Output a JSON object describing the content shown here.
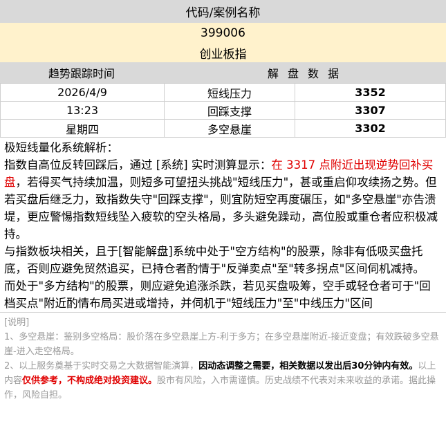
{
  "header": {
    "title": "代码/案例名称"
  },
  "stock": {
    "code": "399006",
    "name": "创业板指"
  },
  "subheader": {
    "col1": "趋势跟踪时间",
    "col2": "解 盘 数 据"
  },
  "rows": [
    {
      "info": "2026/4/9",
      "label": "短线压力",
      "value": "3352"
    },
    {
      "info": "13:23",
      "label": "回踩支撑",
      "value": "3307"
    },
    {
      "info": "星期四",
      "label": "多空悬崖",
      "value": "3302"
    }
  ],
  "analysis": {
    "heading": "极短线量化系统解析：",
    "p1_a": "指数自高位反转回踩后，通过 [系统] 实时测算显示：",
    "p1_red": "在 3317 点附近出现逆势回补买盘",
    "p1_b": "，若得买气持续加温，则短多可望扭头挑战\"短线压力\"，甚或重启仰攻续扬之势。但若买盘后继乏力，致指数失守\"回踩支撑\"，则宜防短空再度碾压，如\"多空悬崖\"亦告溃堤，更应警惕指数短线坠入疲软的空头格局，多头避免躁动，高位股或重仓者应积极减持。",
    "p2": "与指数板块相关，且于[智能解盘]系统中处于\"空方结构\"的股票，除非有低吸买盘托底，否则应避免贸然追买，已持仓者酌情于\"反弹卖点\"至\"转多拐点\"区间伺机减持。",
    "p3": "而处于\"多方结构\"的股票，则应避免追涨杀跌，若见买盘吸筹，空手或轻仓者可于\"回档买点\"附近酌情布局买进或增持，并伺机于\"短线压力\"至\"中线压力\"区间"
  },
  "notes": {
    "title": "[说明]",
    "n1": "1、多空悬崖：鉴别多空格局：股价落在多空悬崖上方-利于多方；在多空悬崖附近-接近变盘；有效跌破多空悬崖-进入走空格局。",
    "n2_a": "2、以上服务奠基于实时交易之大数据智能演算，",
    "n2_bold": "因动态调整之需要，相关数据以发出后30分钟内有效。",
    "n2_b": "以上内容",
    "n2_red": "仅供参考，不构成绝对投资建议。",
    "n2_c": "股市有风险，入市需谨慎。历史战绩不代表对未来收益的承诺。据此操作，风险自担。"
  }
}
